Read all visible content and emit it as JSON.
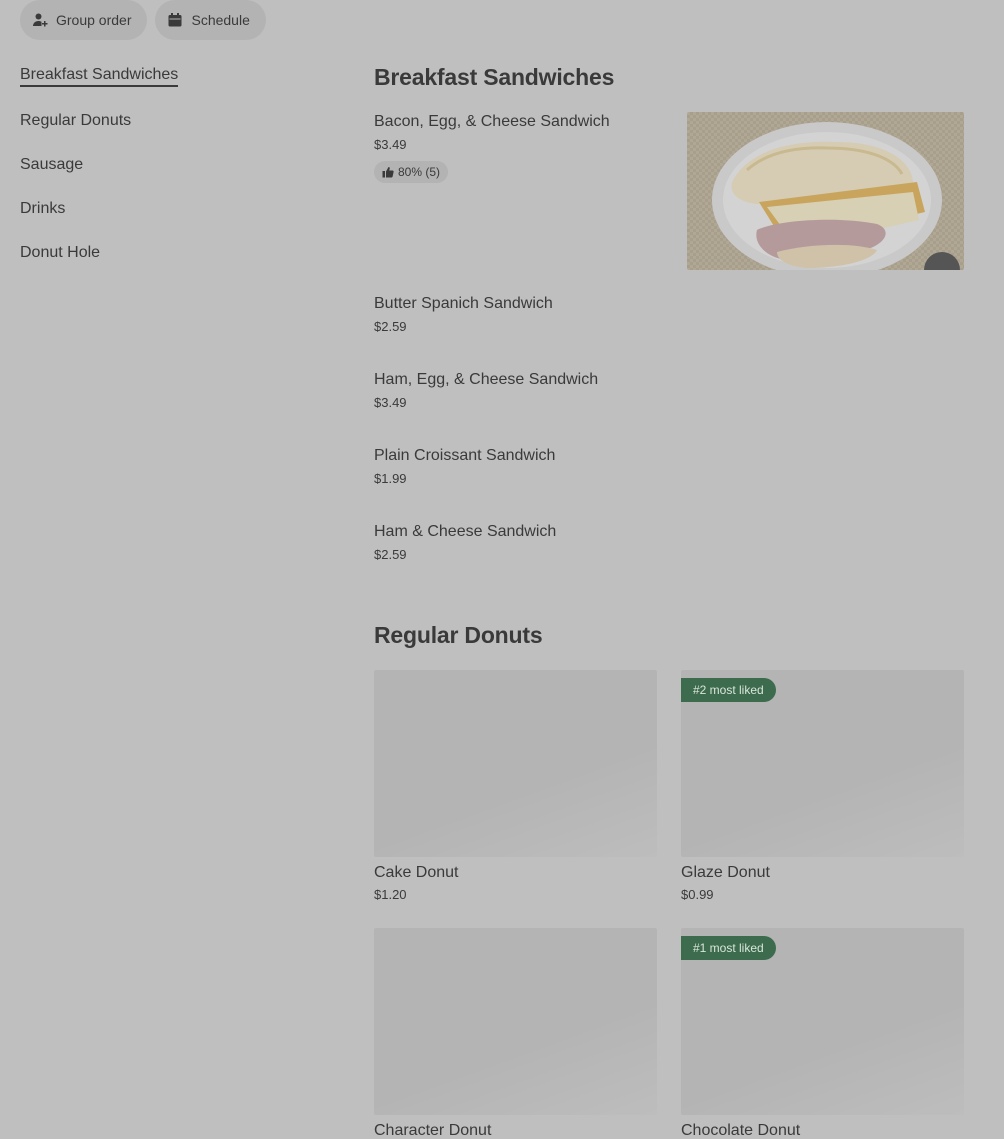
{
  "topbar": {
    "group_order": "Group order",
    "schedule": "Schedule"
  },
  "sidebar": {
    "items": [
      {
        "label": "Breakfast Sandwiches",
        "active": true
      },
      {
        "label": "Regular Donuts"
      },
      {
        "label": "Sausage"
      },
      {
        "label": "Drinks"
      },
      {
        "label": "Donut Hole"
      }
    ]
  },
  "sections": {
    "breakfast": {
      "title": "Breakfast Sandwiches",
      "items": [
        {
          "name": "Bacon, Egg, & Cheese Sandwich",
          "price": "$3.49",
          "rating": "80% (5)"
        },
        {
          "name": "Butter Spanich Sandwich",
          "price": "$2.59"
        },
        {
          "name": "Ham, Egg, & Cheese Sandwich",
          "price": "$3.49"
        },
        {
          "name": "Plain Croissant Sandwich",
          "price": "$1.99"
        },
        {
          "name": "Ham & Cheese Sandwich",
          "price": "$2.59"
        }
      ]
    },
    "donuts": {
      "title": "Regular Donuts",
      "items": [
        {
          "name": "Cake Donut",
          "price": "$1.20"
        },
        {
          "name": "Glaze Donut",
          "price": "$0.99",
          "badge": "#2 most liked"
        },
        {
          "name": "Character Donut"
        },
        {
          "name": "Chocolate Donut",
          "badge": "#1 most liked"
        }
      ]
    }
  },
  "colors": {
    "badge_bg": "#3d6b4d",
    "overlay_bg": "#bfbfbf"
  },
  "icons": [
    "add-person-icon",
    "calendar-icon",
    "thumbs-up-icon"
  ]
}
